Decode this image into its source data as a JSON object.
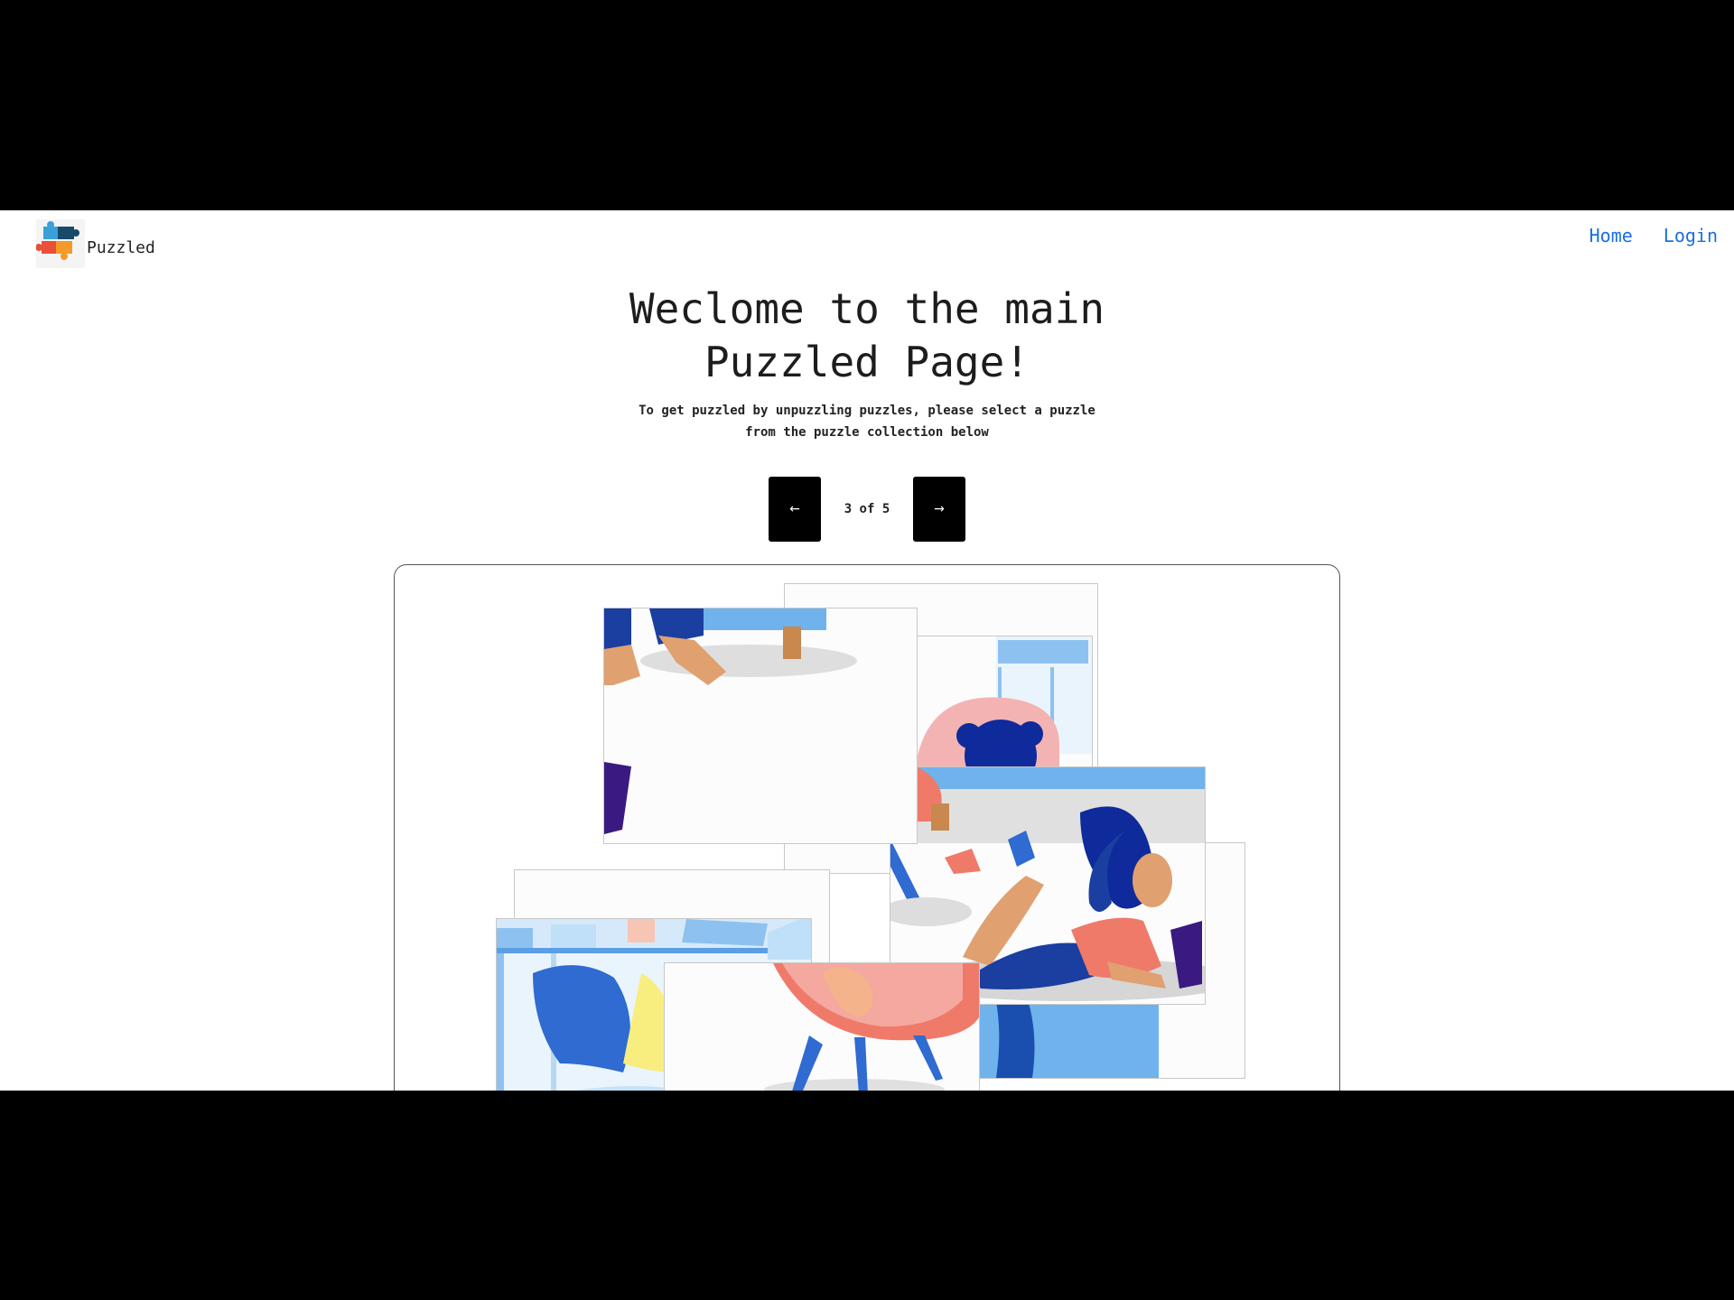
{
  "navbar": {
    "brand": "Puzzled",
    "logo_icon": "puzzle-pieces-logo-icon",
    "links": [
      {
        "label": "Home"
      },
      {
        "label": "Login"
      }
    ],
    "link_color": "#1a6fe0"
  },
  "hero": {
    "title": "Weclome to the main Puzzled Page!",
    "subtitle": "To get puzzled by unpuzzling puzzles, please select a puzzle from the puzzle collection below"
  },
  "pager": {
    "prev_icon": "arrow-left-icon",
    "prev_glyph": "←",
    "current_label": "3 of 5",
    "next_icon": "arrow-right-icon",
    "next_glyph": "→"
  },
  "puzzle": {
    "pieces_count_visible": 10,
    "palette": {
      "dark_blue": "#1a3fa0",
      "blue": "#2f6bd0",
      "light_blue": "#8dc2f0",
      "pink": "#f2a0a0",
      "coral": "#f07a6a",
      "skin": "#e0a070",
      "navy": "#0f2a9a",
      "purple": "#3a1a80",
      "grey_shadow": "#dddddd",
      "yellow": "#f8ee80"
    }
  }
}
